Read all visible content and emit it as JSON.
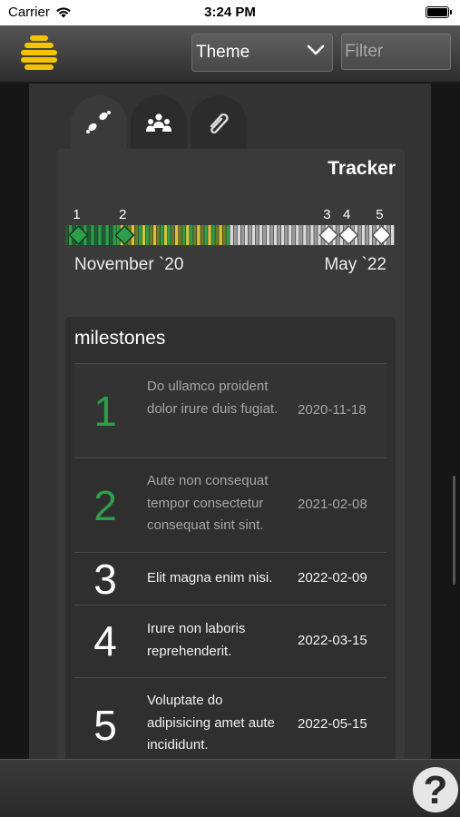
{
  "status": {
    "carrier": "Carrier",
    "time": "3:24 PM"
  },
  "header": {
    "theme_label": "Theme",
    "filter_placeholder": "Filter"
  },
  "tabs": [
    {
      "icon": "footsteps-icon",
      "active": true
    },
    {
      "icon": "people-icon",
      "active": false
    },
    {
      "icon": "paperclip-icon",
      "active": false
    }
  ],
  "tracker": {
    "title": "Tracker",
    "start_label": "November `20",
    "end_label": "May `22",
    "markers": [
      "1",
      "2",
      "3",
      "4",
      "5"
    ],
    "progress_fraction": 0.49,
    "colors": {
      "done": "#2e9d4c",
      "warn": "#d8c33a",
      "pending": "#d9d9d9"
    }
  },
  "milestones": {
    "title": "milestones",
    "items": [
      {
        "num": "1",
        "text": "Do ullamco proident dolor irure duis fugiat.",
        "date": "2020-11-18",
        "done": true
      },
      {
        "num": "2",
        "text": "Aute non consequat tempor consectetur consequat sint sint.",
        "date": "2021-02-08",
        "done": true
      },
      {
        "num": "3",
        "text": "Elit magna enim nisi.",
        "date": "2022-02-09",
        "done": false
      },
      {
        "num": "4",
        "text": "Irure non laboris reprehenderit.",
        "date": "2022-03-15",
        "done": false
      },
      {
        "num": "5",
        "text": "Voluptate do adipisicing amet aute incididunt.",
        "date": "2022-05-15",
        "done": false
      }
    ]
  },
  "footer": {
    "help_label": "?"
  }
}
